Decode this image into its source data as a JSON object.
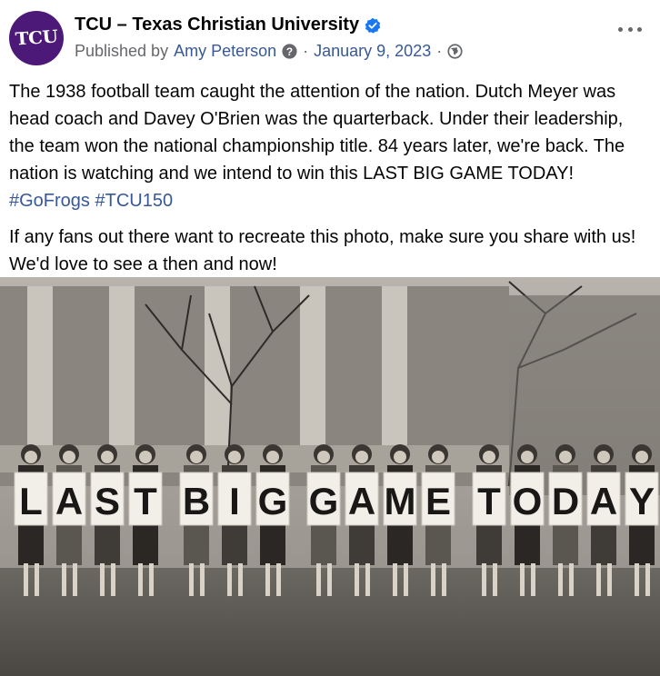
{
  "post": {
    "page_name": "TCU – Texas Christian University",
    "avatar_text": "TCU",
    "published_by_prefix": "Published by",
    "author": "Amy Peterson",
    "date": "January 9, 2023",
    "separator": "·",
    "body_para1": "The 1938 football team caught the attention of the nation. Dutch Meyer was head coach and Davey O'Brien was the quarterback. Under their leadership, the team won the national championship title. 84 years later, we're back. The nation is watching and we intend to win this LAST BIG GAME TODAY!",
    "hashtags": [
      "#GoFrogs",
      "#TCU150"
    ],
    "body_para2": "If any fans out there want to recreate this photo, make sure you share with us! We'd love to see a then and now!"
  },
  "photo": {
    "sign_letters": [
      "L",
      "A",
      "S",
      "T",
      "B",
      "I",
      "G",
      "G",
      "A",
      "M",
      "E",
      "T",
      "O",
      "D",
      "A",
      "Y"
    ]
  },
  "colors": {
    "brand_purple": "#4d1979",
    "verified_blue": "#1877f2",
    "link_blue": "#385898",
    "secondary_gray": "#65676b"
  }
}
